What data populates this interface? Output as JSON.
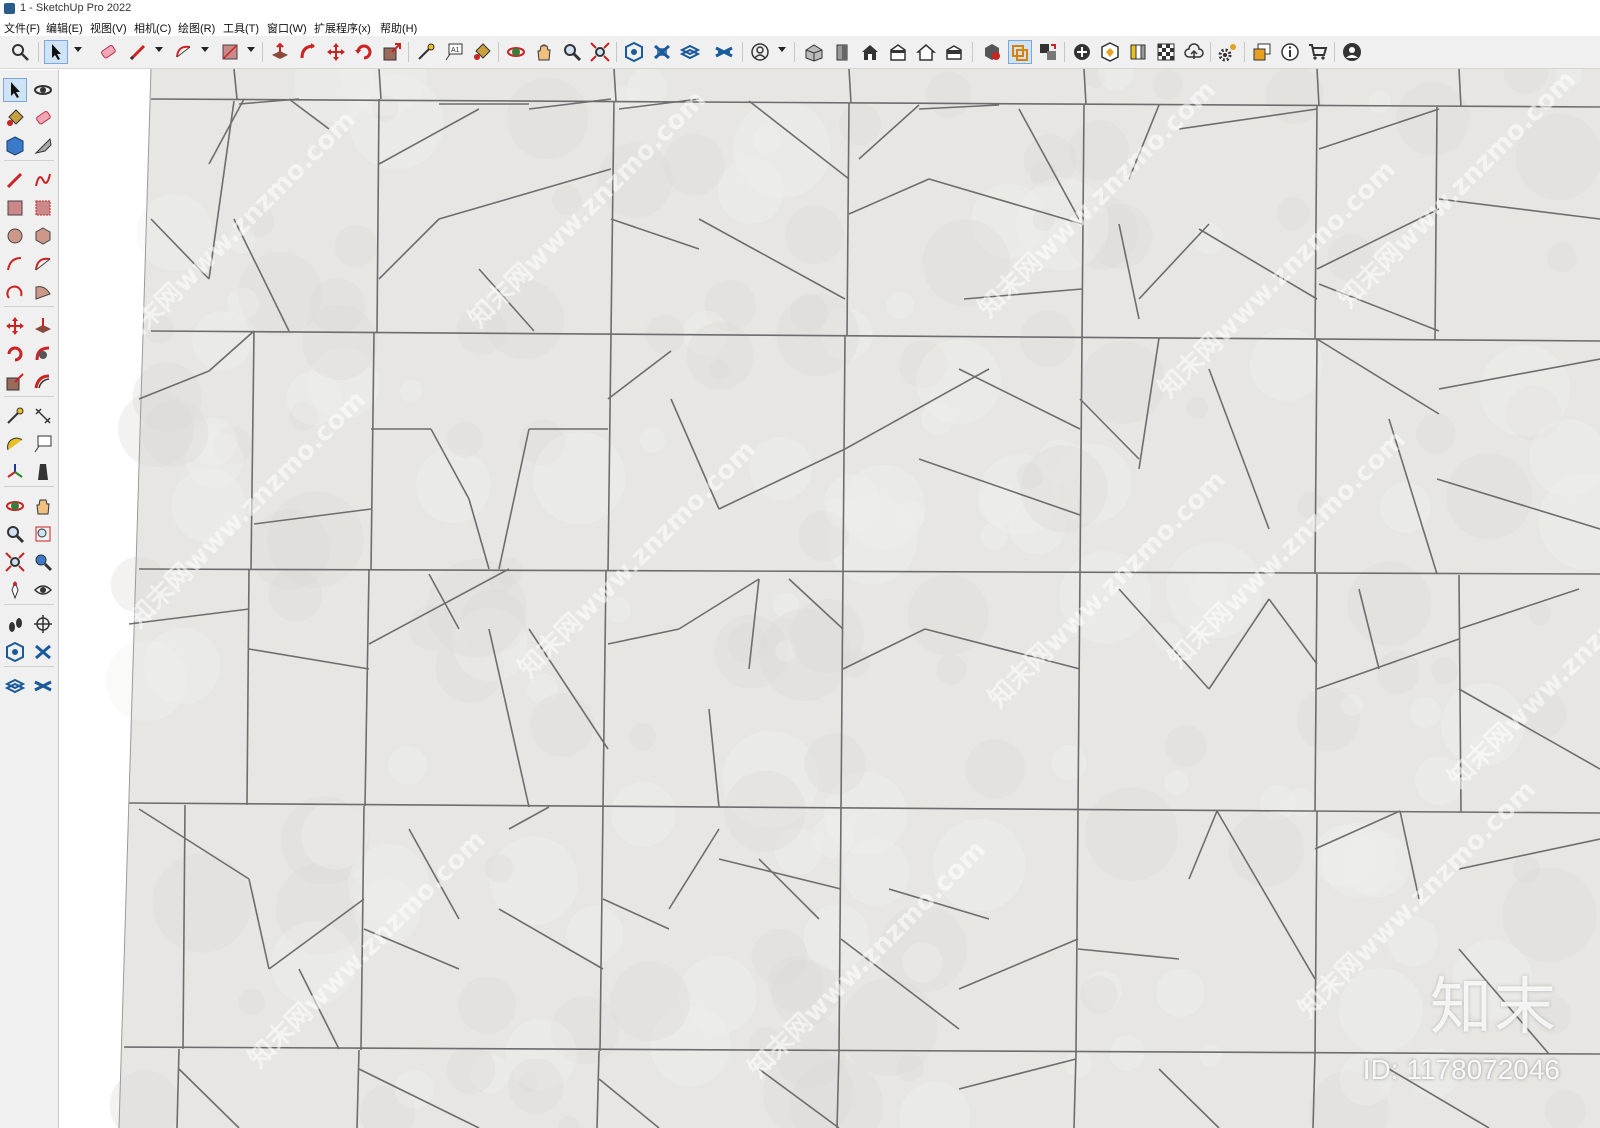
{
  "window": {
    "title": "1 - SketchUp Pro 2022"
  },
  "menu": [
    {
      "id": "file",
      "label": "文件(F)"
    },
    {
      "id": "edit",
      "label": "编辑(E)"
    },
    {
      "id": "view",
      "label": "视图(V)"
    },
    {
      "id": "camera",
      "label": "相机(C)"
    },
    {
      "id": "draw",
      "label": "绘图(R)"
    },
    {
      "id": "tools",
      "label": "工具(T)"
    },
    {
      "id": "window",
      "label": "窗口(W)"
    },
    {
      "id": "extensions",
      "label": "扩展程序(x)"
    },
    {
      "id": "help",
      "label": "帮助(H)"
    }
  ],
  "toolbar_icons": [
    "search-icon",
    "select-icon",
    "eraser-icon",
    "pencil-icon",
    "arc-icon",
    "rectangle-icon",
    "push-pull-icon",
    "follow-me-icon",
    "move-icon",
    "rotate-icon",
    "scale-icon",
    "tape-measure-icon",
    "text-icon",
    "paint-bucket-icon",
    "orbit-icon",
    "pan-icon",
    "zoom-icon",
    "zoom-extents-icon",
    "3d-warehouse-icon",
    "extension-warehouse-icon",
    "layout-icon",
    "sandbox-icon",
    "account-icon",
    "iso-view-icon",
    "front-view-icon",
    "home-view-icon",
    "right-view-icon",
    "back-view-icon",
    "left-view-icon",
    "styles-icon",
    "section-plane-icon",
    "components-icon",
    "add-location-icon",
    "terrain-icon",
    "materials-icon",
    "shadows-icon",
    "cloud-icon",
    "settings-icon",
    "outliner-icon",
    "info-icon",
    "cart-icon",
    "user-icon"
  ],
  "left_tools": [
    "select-tool-icon",
    "orbit-tool-icon",
    "paint-tool-icon",
    "eraser-tool-icon",
    "component-tool-icon",
    "tag-tool-icon",
    "line-tool-icon",
    "freehand-tool-icon",
    "rectangle-tool-icon",
    "rotated-rect-tool-icon",
    "circle-tool-icon",
    "polygon-tool-icon",
    "arc-tool-icon",
    "two-point-arc-icon",
    "three-point-arc-icon",
    "pie-tool-icon",
    "move-tool-icon",
    "push-pull-tool-icon",
    "rotate-tool-icon",
    "follow-me-tool-icon",
    "scale-tool-icon",
    "offset-tool-icon",
    "tape-tool-icon",
    "dimension-tool-icon",
    "protractor-tool-icon",
    "text-tool-icon",
    "axes-tool-icon",
    "3d-text-tool-icon",
    "orbit-nav-icon",
    "pan-nav-icon",
    "zoom-nav-icon",
    "zoom-window-icon",
    "zoom-extents-nav-icon",
    "previous-view-icon",
    "position-camera-icon",
    "look-around-icon",
    "walk-icon",
    "section-tool-icon",
    "warehouse-tool-icon",
    "extension-tool-icon",
    "layout-tool-icon",
    "sandbox-tool-icon"
  ],
  "colors": {
    "accent": "#cfe3f7",
    "tile": "#e7e6e3",
    "grout": "#6d6d6d",
    "chrome": "#f0f0f0"
  },
  "watermark": {
    "site": "知末网www.znzmo.com",
    "logo": "知末",
    "id": "ID: 1178072046"
  }
}
